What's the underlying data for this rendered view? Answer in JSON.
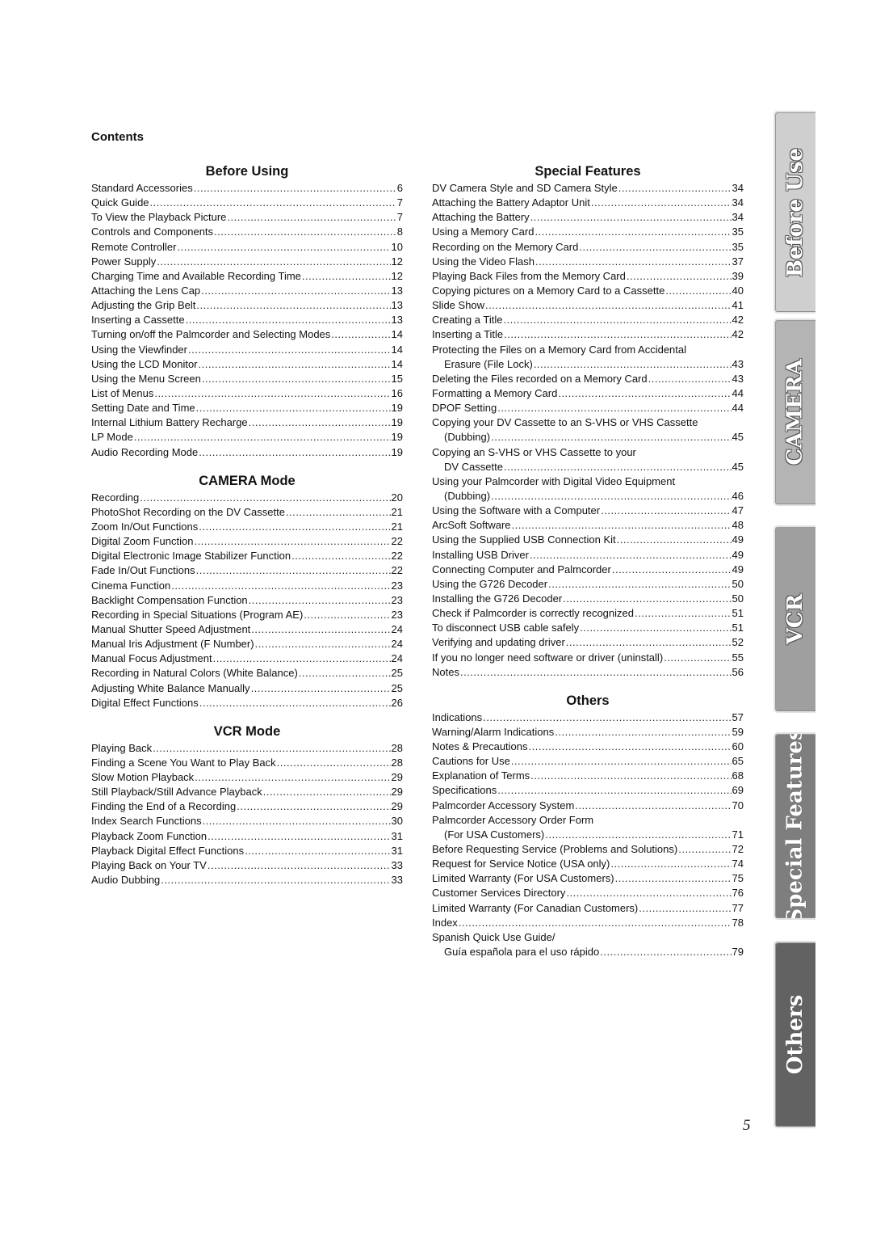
{
  "contents_label": "Contents",
  "page_number": "5",
  "tabs": [
    "Before Use",
    "CAMERA",
    "VCR",
    "Special Features",
    "Others"
  ],
  "tab_colors": {
    "before_use": "#cfcfcf",
    "camera": "#b4b4b4",
    "vcr": "#9f9f9f",
    "special_features": "#7e7e7e",
    "others": "#626262"
  },
  "sections": {
    "before_using": {
      "title": "Before Using",
      "entries": [
        {
          "t": "Standard Accessories",
          "p": "6"
        },
        {
          "t": "Quick Guide",
          "p": "7"
        },
        {
          "t": "To View the Playback Picture",
          "p": "7"
        },
        {
          "t": "Controls and Components",
          "p": "8"
        },
        {
          "t": "Remote Controller",
          "p": "10"
        },
        {
          "t": "Power Supply",
          "p": "12"
        },
        {
          "t": "Charging Time and Available Recording Time",
          "p": "12"
        },
        {
          "t": "Attaching the Lens Cap",
          "p": "13"
        },
        {
          "t": "Adjusting the Grip Belt",
          "p": "13"
        },
        {
          "t": "Inserting a Cassette",
          "p": "13"
        },
        {
          "t": "Turning on/off the Palmcorder and Selecting Modes",
          "p": "14"
        },
        {
          "t": "Using the Viewfinder",
          "p": "14"
        },
        {
          "t": "Using the LCD Monitor",
          "p": "14"
        },
        {
          "t": "Using the Menu Screen",
          "p": "15"
        },
        {
          "t": "List of Menus",
          "p": "16"
        },
        {
          "t": "Setting Date and Time",
          "p": "19"
        },
        {
          "t": "Internal Lithium Battery Recharge",
          "p": "19"
        },
        {
          "t": "LP Mode",
          "p": "19"
        },
        {
          "t": "Audio Recording Mode",
          "p": "19"
        }
      ]
    },
    "camera_mode": {
      "title": "CAMERA Mode",
      "entries": [
        {
          "t": "Recording",
          "p": "20"
        },
        {
          "t": "PhotoShot Recording on the DV Cassette",
          "p": "21"
        },
        {
          "t": "Zoom In/Out Functions",
          "p": "21"
        },
        {
          "t": "Digital Zoom Function",
          "p": "22"
        },
        {
          "t": "Digital Electronic Image Stabilizer Function",
          "p": "22"
        },
        {
          "t": "Fade In/Out Functions",
          "p": "22"
        },
        {
          "t": "Cinema Function",
          "p": "23"
        },
        {
          "t": "Backlight Compensation Function",
          "p": "23"
        },
        {
          "t": "Recording in Special Situations (Program AE)",
          "p": "23"
        },
        {
          "t": "Manual Shutter Speed Adjustment",
          "p": "24"
        },
        {
          "t": "Manual Iris Adjustment (F Number)",
          "p": "24"
        },
        {
          "t": "Manual Focus Adjustment",
          "p": "24"
        },
        {
          "t": "Recording in Natural Colors (White Balance)",
          "p": "25"
        },
        {
          "t": "Adjusting White Balance Manually",
          "p": "25"
        },
        {
          "t": "Digital Effect Functions",
          "p": "26"
        }
      ]
    },
    "vcr_mode": {
      "title": "VCR Mode",
      "entries": [
        {
          "t": "Playing Back",
          "p": "28"
        },
        {
          "t": "Finding a Scene You Want to Play Back",
          "p": "28"
        },
        {
          "t": "Slow Motion Playback",
          "p": "29"
        },
        {
          "t": "Still Playback/Still Advance Playback",
          "p": "29"
        },
        {
          "t": "Finding the End of a Recording",
          "p": "29"
        },
        {
          "t": "Index Search Functions",
          "p": "30"
        },
        {
          "t": "Playback Zoom Function",
          "p": "31"
        },
        {
          "t": "Playback Digital Effect Functions",
          "p": "31"
        },
        {
          "t": "Playing Back on Your TV",
          "p": "33"
        },
        {
          "t": "Audio Dubbing",
          "p": "33"
        }
      ]
    },
    "special_features": {
      "title": "Special Features",
      "entries": [
        {
          "t": "DV Camera Style and SD Camera Style",
          "p": "34"
        },
        {
          "t": "Attaching the Battery Adaptor Unit",
          "p": "34"
        },
        {
          "t": "Attaching the Battery",
          "p": "34"
        },
        {
          "t": "Using a Memory Card",
          "p": "35"
        },
        {
          "t": "Recording on the Memory Card",
          "p": "35"
        },
        {
          "t": "Using the Video Flash",
          "p": "37"
        },
        {
          "t": "Playing Back Files from the Memory Card",
          "p": "39"
        },
        {
          "t": "Copying pictures on a Memory Card to a Cassette",
          "p": "40"
        },
        {
          "t": "Slide Show",
          "p": "41"
        },
        {
          "t": "Creating a Title",
          "p": "42"
        },
        {
          "t": "Inserting a Title",
          "p": "42"
        },
        {
          "t": "Protecting the Files on a Memory Card from Accidental",
          "p": "",
          "kind": "head"
        },
        {
          "t": "Erasure (File Lock)",
          "p": "43",
          "kind": "indent"
        },
        {
          "t": "Deleting the Files recorded on a Memory Card",
          "p": "43"
        },
        {
          "t": "Formatting a Memory Card",
          "p": "44"
        },
        {
          "t": "DPOF Setting",
          "p": "44"
        },
        {
          "t": "Copying your DV Cassette to an S-VHS or VHS Cassette",
          "p": "",
          "kind": "head"
        },
        {
          "t": "(Dubbing)",
          "p": "45",
          "kind": "indent"
        },
        {
          "t": "Copying an S-VHS or VHS Cassette to your",
          "p": "",
          "kind": "head"
        },
        {
          "t": "DV Cassette",
          "p": "45",
          "kind": "indent"
        },
        {
          "t": "Using your Palmcorder with Digital Video Equipment",
          "p": "",
          "kind": "head"
        },
        {
          "t": "(Dubbing)",
          "p": "46",
          "kind": "indent"
        },
        {
          "t": "Using the Software with a Computer",
          "p": "47"
        },
        {
          "t": "ArcSoft Software",
          "p": "48"
        },
        {
          "t": "Using the Supplied USB Connection Kit",
          "p": "49"
        },
        {
          "t": "Installing USB Driver",
          "p": "49"
        },
        {
          "t": "Connecting Computer and Palmcorder",
          "p": "49"
        },
        {
          "t": "Using the G726 Decoder",
          "p": "50"
        },
        {
          "t": "Installing the G726 Decoder",
          "p": "50"
        },
        {
          "t": "Check if Palmcorder is correctly recognized",
          "p": "51"
        },
        {
          "t": "To disconnect USB cable safely",
          "p": "51"
        },
        {
          "t": "Verifying and updating driver",
          "p": "52"
        },
        {
          "t": "If you no longer need software or driver (uninstall)",
          "p": "55"
        },
        {
          "t": "Notes",
          "p": "56"
        }
      ]
    },
    "others": {
      "title": "Others",
      "entries": [
        {
          "t": "Indications",
          "p": "57"
        },
        {
          "t": "Warning/Alarm Indications",
          "p": "59"
        },
        {
          "t": "Notes & Precautions",
          "p": "60"
        },
        {
          "t": "Cautions for Use",
          "p": "65"
        },
        {
          "t": "Explanation of Terms",
          "p": "68"
        },
        {
          "t": "Specifications",
          "p": "69"
        },
        {
          "t": "Palmcorder Accessory System",
          "p": "70"
        },
        {
          "t": "Palmcorder Accessory Order Form",
          "p": "",
          "kind": "head"
        },
        {
          "t": "(For USA Customers)",
          "p": "71",
          "kind": "indent"
        },
        {
          "t": "Before Requesting Service (Problems and Solutions)",
          "p": "72"
        },
        {
          "t": "Request for Service Notice (USA only)",
          "p": "74"
        },
        {
          "t": "Limited Warranty (For USA Customers)",
          "p": "75"
        },
        {
          "t": "Customer Services Directory",
          "p": "76"
        },
        {
          "t": "Limited Warranty (For Canadian Customers)",
          "p": "77"
        },
        {
          "t": "Index",
          "p": "78"
        },
        {
          "t": "Spanish Quick Use Guide/",
          "p": "",
          "kind": "head"
        },
        {
          "t": "Guía española para el uso rápido",
          "p": "79",
          "kind": "indent"
        }
      ]
    }
  }
}
